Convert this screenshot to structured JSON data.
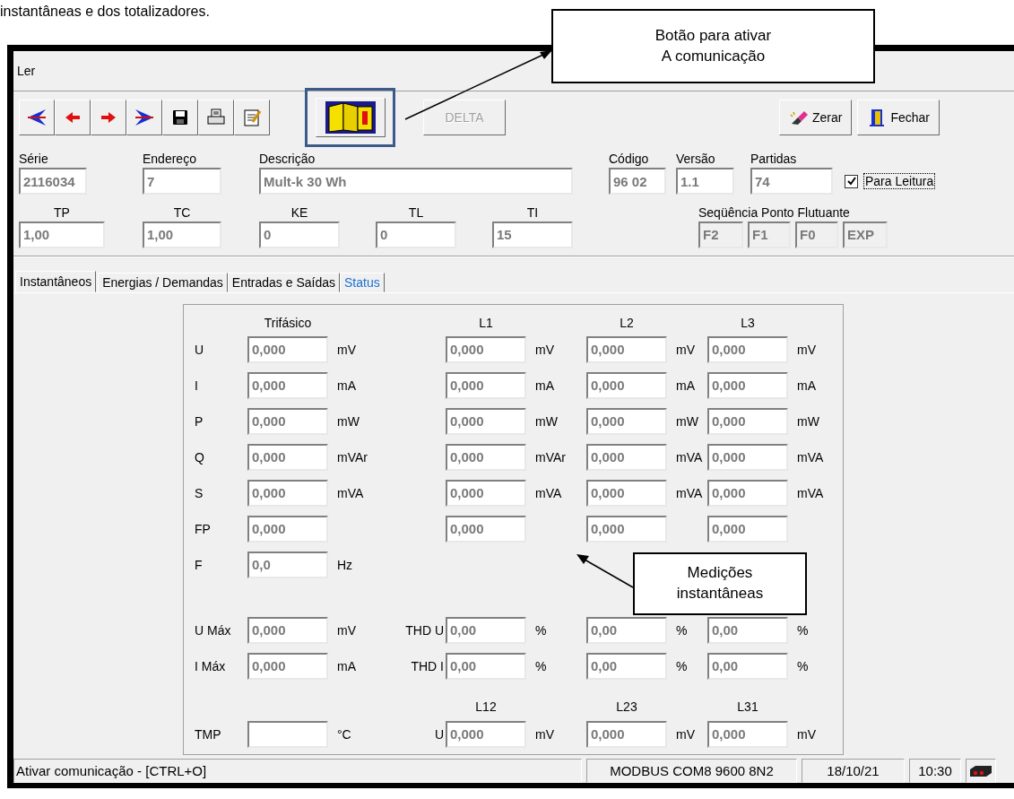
{
  "intro_text": "instantâneas e dos totalizadores.",
  "window": {
    "title": "Ler"
  },
  "toolbar": {
    "left_buttons": [
      {
        "kind": "first"
      },
      {
        "kind": "prev"
      },
      {
        "kind": "next"
      },
      {
        "kind": "last"
      },
      {
        "kind": "save"
      },
      {
        "kind": "print"
      },
      {
        "kind": "edit"
      }
    ],
    "connect_button": {
      "highlighted": true
    },
    "delta_button": {
      "label": "DELTA",
      "disabled": true
    },
    "right_buttons": [
      {
        "kind": "clear",
        "label": "Zerar"
      },
      {
        "kind": "close",
        "label": "Fechar"
      }
    ]
  },
  "header_row_1": [
    {
      "label": "Série",
      "value": "2116034"
    },
    {
      "label": "Endereço",
      "value": "7"
    },
    {
      "label": "Descrição",
      "value": "Mult-k 30 Wh"
    },
    {
      "label": "Código",
      "value": "96 02"
    },
    {
      "label": "Versão",
      "value": "1.1"
    },
    {
      "label": "Partidas",
      "value": "74"
    }
  ],
  "read_checkbox": {
    "label": "Para Leitura",
    "checked": true
  },
  "header_row_2": [
    {
      "label": "TP",
      "value": "1,00"
    },
    {
      "label": "TC",
      "value": "1,00"
    },
    {
      "label": "KE",
      "value": "0"
    },
    {
      "label": "TL",
      "value": "0"
    },
    {
      "label": "TI",
      "value": "15"
    }
  ],
  "float_sequence": {
    "label": "Seqüência Ponto Flutuante",
    "fields": [
      {
        "value": "F2",
        "disabled": true
      },
      {
        "value": "F1",
        "disabled": true
      },
      {
        "value": "F0",
        "disabled": true
      },
      {
        "value": "EXP",
        "disabled": true
      }
    ]
  },
  "tabs": [
    {
      "label": "Instantâneos",
      "selected": true,
      "color": "#000000"
    },
    {
      "label": "Energias / Demandas",
      "selected": false,
      "color": "#000000"
    },
    {
      "label": "Entradas e Saídas",
      "selected": false,
      "color": "#000000"
    },
    {
      "label": "Status",
      "selected": false,
      "color": "#1a6fd0"
    }
  ],
  "sections": [
    {
      "kind": "phase",
      "columns": [
        "Trifásico",
        "L1",
        "L2",
        "L3"
      ],
      "rows": [
        {
          "label": "U",
          "cells": [
            {
              "value": "0,000",
              "unit": "mV"
            },
            {
              "value": "0,000",
              "unit": "mV"
            },
            {
              "value": "0,000",
              "unit": "mV"
            },
            {
              "value": "0,000",
              "unit": "mV"
            }
          ]
        },
        {
          "label": "I",
          "cells": [
            {
              "value": "0,000",
              "unit": "mA"
            },
            {
              "value": "0,000",
              "unit": "mA"
            },
            {
              "value": "0,000",
              "unit": "mA"
            },
            {
              "value": "0,000",
              "unit": "mA"
            }
          ]
        },
        {
          "label": "P",
          "cells": [
            {
              "value": "0,000",
              "unit": "mW"
            },
            {
              "value": "0,000",
              "unit": "mW"
            },
            {
              "value": "0,000",
              "unit": "mW"
            },
            {
              "value": "0,000",
              "unit": "mW"
            }
          ]
        },
        {
          "label": "Q",
          "cells": [
            {
              "value": "0,000",
              "unit": "mVAr"
            },
            {
              "value": "0,000",
              "unit": "mVAr"
            },
            {
              "value": "0,000",
              "unit": "mVA"
            },
            {
              "value": "0,000",
              "unit": "mVA"
            }
          ]
        },
        {
          "label": "S",
          "cells": [
            {
              "value": "0,000",
              "unit": "mVA"
            },
            {
              "value": "0,000",
              "unit": "mVA"
            },
            {
              "value": "0,000",
              "unit": "mVA"
            },
            {
              "value": "0,000",
              "unit": "mVA"
            }
          ]
        },
        {
          "label": "FP",
          "cells": [
            {
              "value": "0,000"
            },
            {
              "value": "0,000"
            },
            {
              "value": "0,000"
            },
            {
              "value": "0,000"
            }
          ]
        },
        {
          "label": "F",
          "cells": [
            {
              "value": "0,0",
              "unit": "Hz"
            }
          ]
        }
      ]
    },
    {
      "kind": "maxima",
      "rows": [
        {
          "label": "U Máx",
          "mid_label": "THD U",
          "cells": [
            {
              "value": "0,000",
              "unit": "mV"
            },
            {
              "value": "0,00",
              "unit": "%"
            },
            {
              "value": "0,00",
              "unit": "%"
            },
            {
              "value": "0,00",
              "unit": "%"
            }
          ]
        },
        {
          "label": "I Máx",
          "mid_label": "THD I",
          "cells": [
            {
              "value": "0,000",
              "unit": "mA"
            },
            {
              "value": "0,00",
              "unit": "%"
            },
            {
              "value": "0,00",
              "unit": "%"
            },
            {
              "value": "0,00",
              "unit": "%"
            }
          ]
        }
      ]
    },
    {
      "kind": "line",
      "columns": [
        "",
        "L12",
        "L23",
        "L31"
      ],
      "rows": [
        {
          "label": "TMP",
          "mid_label": "U",
          "cells": [
            {
              "unit": "°C"
            },
            {
              "value": "0,000",
              "unit": "mV"
            },
            {
              "value": "0,000",
              "unit": "mV"
            },
            {
              "value": "0,000",
              "unit": "mV"
            }
          ]
        }
      ]
    }
  ],
  "status_bar": {
    "message": "Ativar comunicação - [CTRL+O]",
    "connection": "MODBUS COM8 9600 8N2",
    "date": "18/10/21",
    "time": "10:30"
  },
  "callouts": [
    {
      "kind": "button",
      "text": "Botão para ativar\nA comunicação"
    },
    {
      "kind": "measurements",
      "text": "Medições\ninstantâneas"
    }
  ]
}
